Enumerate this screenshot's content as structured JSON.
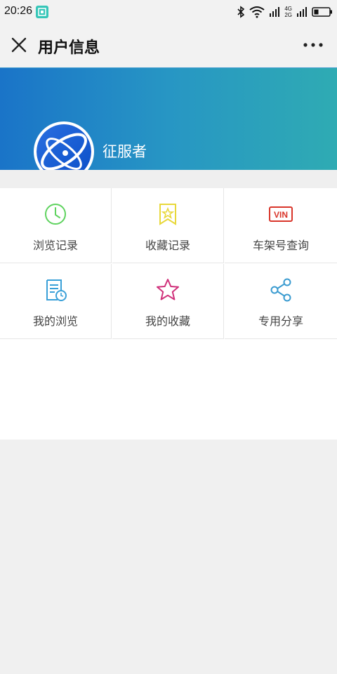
{
  "status_bar": {
    "time": "20:26",
    "network_labels": [
      "4G",
      "2G"
    ]
  },
  "nav": {
    "title": "用户信息"
  },
  "profile": {
    "username": "征服者"
  },
  "grid": {
    "items": [
      {
        "label": "浏览记录",
        "icon": "clock-icon",
        "color": "#5fd35f"
      },
      {
        "label": "收藏记录",
        "icon": "bookmark-star-icon",
        "color": "#e8d83a"
      },
      {
        "label": "车架号查询",
        "icon": "vin-icon",
        "color": "#d9352a"
      },
      {
        "label": "我的浏览",
        "icon": "document-clock-icon",
        "color": "#3aa0d8"
      },
      {
        "label": "我的收藏",
        "icon": "star-icon",
        "color": "#d0307a"
      },
      {
        "label": "专用分享",
        "icon": "share-icon",
        "color": "#3a9bd0"
      }
    ]
  },
  "colors": {
    "banner_start": "#1a74c8",
    "banner_end": "#2fabb3"
  }
}
